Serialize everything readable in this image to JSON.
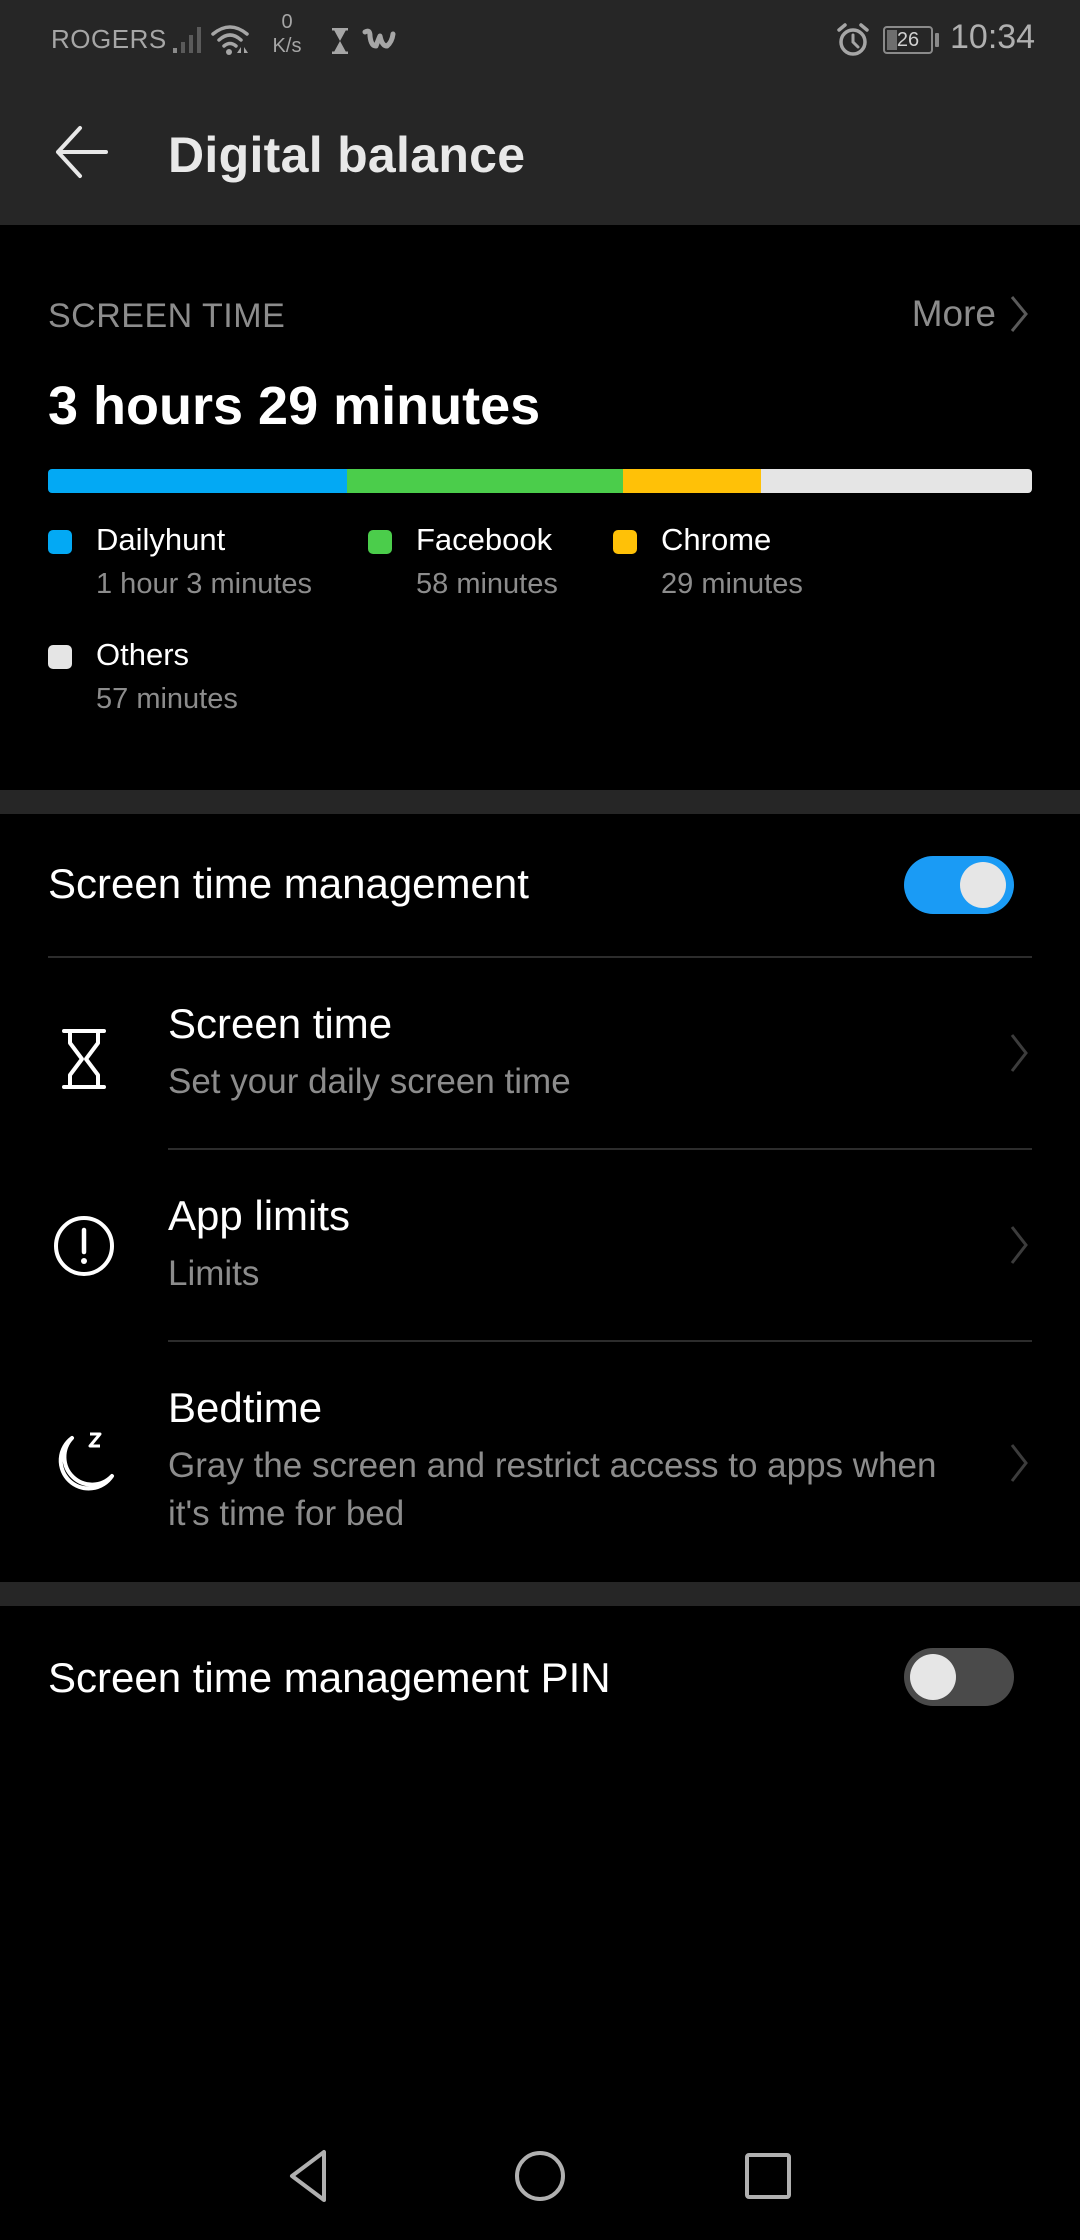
{
  "status_bar": {
    "carrier": "ROGERS",
    "net_speed_value": "0",
    "net_speed_unit": "K/s",
    "battery_level": "26",
    "time": "10:34",
    "icons": [
      "signal-icon",
      "wifi-icon",
      "hourglass-icon",
      "wish-app-icon",
      "alarm-icon",
      "battery-icon"
    ]
  },
  "app_bar": {
    "back_icon": "arrow-left-icon",
    "title": "Digital balance"
  },
  "screen_time_card": {
    "label": "SCREEN TIME",
    "more_label": "More",
    "total": "3 hours 29 minutes",
    "apps": [
      {
        "name": "Dailyhunt",
        "duration": "1 hour 3 minutes",
        "minutes": 63,
        "color": "#03a9f4"
      },
      {
        "name": "Facebook",
        "duration": "58 minutes",
        "minutes": 58,
        "color": "#4bcd4b"
      },
      {
        "name": "Chrome",
        "duration": "29 minutes",
        "minutes": 29,
        "color": "#ffc107"
      },
      {
        "name": "Others",
        "duration": "57 minutes",
        "minutes": 57,
        "color": "#e5e5e5"
      }
    ]
  },
  "settings": {
    "management_toggle": {
      "label": "Screen time management",
      "on": true,
      "accent": "#1a9bf5"
    },
    "items": [
      {
        "title": "Screen time",
        "subtitle": "Set your daily screen time",
        "icon": "hourglass-icon"
      },
      {
        "title": "App limits",
        "subtitle": "Limits",
        "icon": "exclamation-circle-icon"
      },
      {
        "title": "Bedtime",
        "subtitle": "Gray the screen and restrict access to apps when it's time for bed",
        "icon": "moon-sleep-icon"
      }
    ],
    "pin_toggle": {
      "label": "Screen time management PIN",
      "on": false
    }
  },
  "nav_bar": {
    "back": "nav-back-icon",
    "home": "nav-home-icon",
    "recents": "nav-recents-icon"
  }
}
